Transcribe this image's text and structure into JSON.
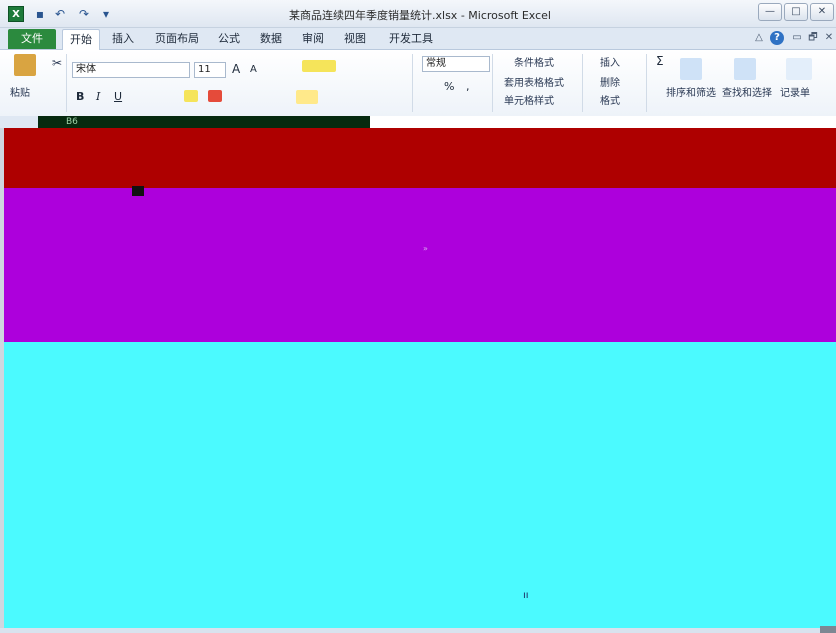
{
  "window": {
    "title": "某商品连续四年季度销量统计.xlsx - Microsoft Excel",
    "app_icon": "X",
    "minimize": "—",
    "maximize": "□",
    "close": "✕"
  },
  "qat": {
    "save_icon": "▪",
    "undo_icon": "↶",
    "redo_icon": "↷",
    "customize_icon": "▾"
  },
  "tabs": {
    "file": "文件",
    "items": [
      "开始",
      "插入",
      "页面布局",
      "公式",
      "数据",
      "审阅",
      "视图",
      "开发工具"
    ]
  },
  "tab_right": {
    "minimize_ribbon": "△",
    "help": "?",
    "restore": "▭",
    "doc_restore": "🗗",
    "doc_close": "✕"
  },
  "ribbon": {
    "paste_label": "粘贴",
    "cut_icon": "✂",
    "font_name": "宋体",
    "font_size": "11",
    "grow_font": "A",
    "shrink_font": "A",
    "bold": "B",
    "italic": "I",
    "underline": "U",
    "number_format": "常规",
    "percent": "%",
    "comma": ",",
    "cond_format": "条件格式",
    "table_format": "套用表格格式",
    "cell_styles": "单元格样式",
    "insert": "插入",
    "delete": "删除",
    "format": "格式",
    "sum": "Σ",
    "sort_filter": "排序和筛选",
    "find_select": "查找和选择",
    "record": "记录单"
  },
  "formula": {
    "cell_ref": "B6"
  },
  "sheet": {
    "page_break_glyph": "ıı",
    "scroll_glyph": "»"
  },
  "colors": {
    "red_band": "#ae0000",
    "purple_band": "#ad00dc",
    "cyan_band": "#4bfaff",
    "file_tab": "#2b8a3e"
  }
}
